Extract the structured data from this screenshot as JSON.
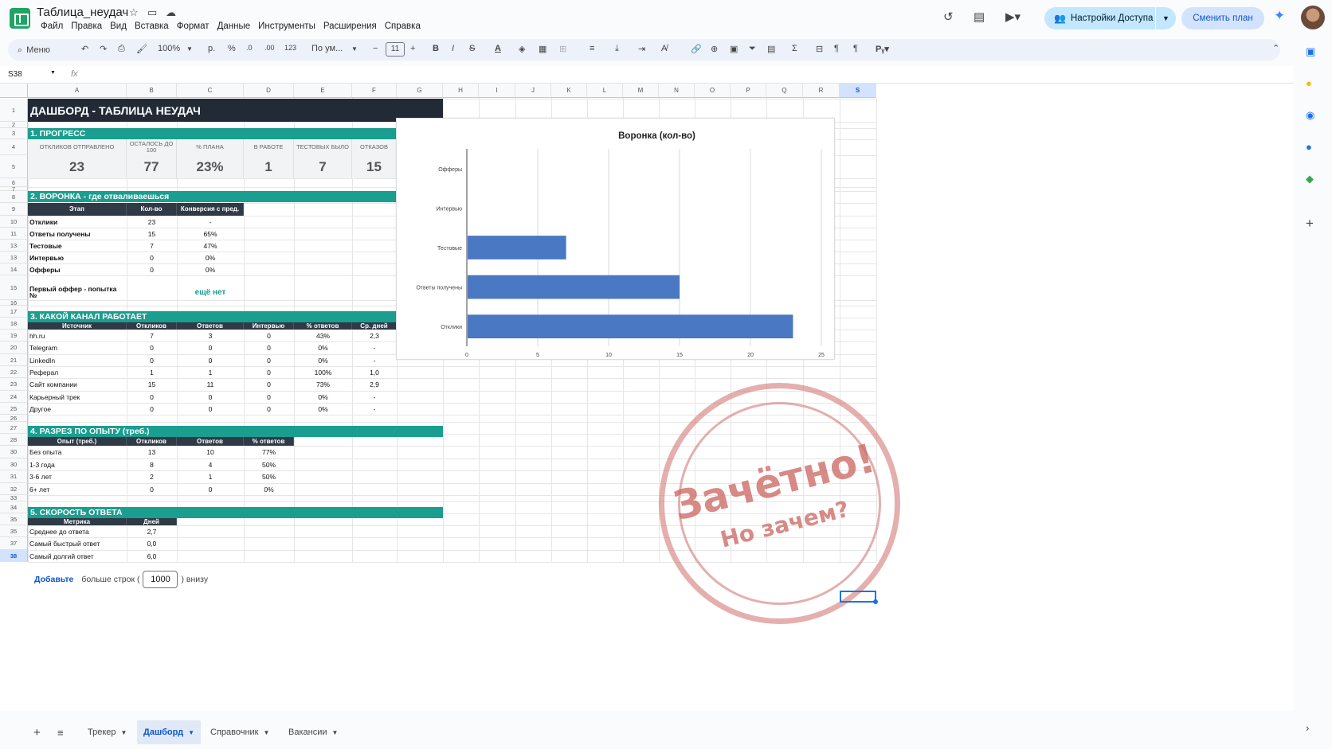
{
  "app": {
    "doc_title": "Таблица_неудач",
    "menu": [
      "Файл",
      "Правка",
      "Вид",
      "Вставка",
      "Формат",
      "Данные",
      "Инструменты",
      "Расширения",
      "Справка"
    ],
    "share_label": "Настройки Доступа",
    "plan_label": "Сменить план"
  },
  "toolbar": {
    "menu_label": "Меню",
    "zoom": "100%",
    "currency": "р.",
    "percent": "%",
    "dec_less": ".0",
    "dec_more": ".00",
    "number_format": "123",
    "font": "По ум...",
    "font_size": "11"
  },
  "formula": {
    "cell_ref": "S38",
    "fx": "fx"
  },
  "columns": [
    "A",
    "B",
    "C",
    "D",
    "E",
    "F",
    "G",
    "H",
    "I",
    "J",
    "K",
    "L",
    "M",
    "N",
    "O",
    "P",
    "Q",
    "R",
    "S"
  ],
  "rows": [
    "1",
    "2",
    "3",
    "4",
    "5",
    "6",
    "7",
    "8",
    "9",
    "10",
    "11",
    "13",
    "13",
    "14",
    "15",
    "16",
    "17",
    "18",
    "19",
    "20",
    "21",
    "22",
    "23",
    "24",
    "25",
    "26",
    "27",
    "28",
    "30",
    "30",
    "31",
    "32",
    "33",
    "34",
    "35",
    "35",
    "37",
    "38"
  ],
  "dashboard": {
    "title": "ДАШБОРД - ТАБЛИЦА НЕУДАЧ",
    "s1": {
      "title": "1. ПРОГРЕСС",
      "labels": [
        "ОТКЛИКОВ ОТПРАВЛЕНО",
        "ОСТАЛОСЬ ДО 100",
        "% ПЛАНА",
        "В РАБОТЕ",
        "ТЕСТОВЫХ БЫЛО",
        "ОТКАЗОВ"
      ],
      "values": [
        "23",
        "77",
        "23%",
        "1",
        "7",
        "15"
      ]
    },
    "s2": {
      "title": "2. ВОРОНКА - где отваливаешься",
      "headers": [
        "Этап",
        "Кол-во",
        "Конверсия с пред."
      ],
      "rows": [
        [
          "Отклики",
          "23",
          "-"
        ],
        [
          "Ответы получены",
          "15",
          "65%"
        ],
        [
          "Тестовые",
          "7",
          "47%"
        ],
        [
          "Интервью",
          "0",
          "0%"
        ],
        [
          "Офферы",
          "0",
          "0%"
        ]
      ],
      "first_offer_label": "Первый оффер - попытка №",
      "first_offer_value": "ещё нет"
    },
    "s3": {
      "title": "3. КАКОЙ КАНАЛ РАБОТАЕТ",
      "headers": [
        "Источник",
        "Откликов",
        "Ответов",
        "Интервью",
        "% ответов",
        "Ср. дней"
      ],
      "rows": [
        [
          "hh.ru",
          "7",
          "3",
          "0",
          "43%",
          "2,3"
        ],
        [
          "Telegram",
          "0",
          "0",
          "0",
          "0%",
          "-"
        ],
        [
          "LinkedIn",
          "0",
          "0",
          "0",
          "0%",
          "-"
        ],
        [
          "Реферал",
          "1",
          "1",
          "0",
          "100%",
          "1,0"
        ],
        [
          "Сайт компании",
          "15",
          "11",
          "0",
          "73%",
          "2,9"
        ],
        [
          "Карьерный трек",
          "0",
          "0",
          "0",
          "0%",
          "-"
        ],
        [
          "Другое",
          "0",
          "0",
          "0",
          "0%",
          "-"
        ]
      ]
    },
    "s4": {
      "title": "4. РАЗРЕЗ ПО ОПЫТУ (треб.)",
      "headers": [
        "Опыт (треб.)",
        "Откликов",
        "Ответов",
        "% ответов"
      ],
      "rows": [
        [
          "Без опыта",
          "13",
          "10",
          "77%"
        ],
        [
          "1-3 года",
          "8",
          "4",
          "50%"
        ],
        [
          "3-6 лет",
          "2",
          "1",
          "50%"
        ],
        [
          "6+ лет",
          "0",
          "0",
          "0%"
        ]
      ]
    },
    "s5": {
      "title": "5. СКОРОСТЬ ОТВЕТА",
      "headers": [
        "Метрика",
        "Дней"
      ],
      "rows": [
        [
          "Среднее до ответа",
          "2,7"
        ],
        [
          "Самый быстрый ответ",
          "0,0"
        ],
        [
          "Самый долгий ответ",
          "6,0"
        ]
      ]
    }
  },
  "chart_data": {
    "type": "bar",
    "orientation": "horizontal",
    "title": "Воронка (кол-во)",
    "categories": [
      "Офферы",
      "Интервью",
      "Тестовые",
      "Ответы получены",
      "Отклики"
    ],
    "values": [
      0,
      0,
      7,
      15,
      23
    ],
    "xlim": [
      0,
      25
    ],
    "xticks": [
      "0",
      "5",
      "10",
      "15",
      "20",
      "25"
    ],
    "grid": true,
    "color": "#4a78c2"
  },
  "stamp": {
    "line1": "Зачётно!",
    "line2": "Но зачем?"
  },
  "add_rows": {
    "link": "Добавьте",
    "text_before": "больше строк (",
    "count": "1000",
    "text_after": ") внизу"
  },
  "sheets": [
    {
      "name": "Трекер",
      "active": false
    },
    {
      "name": "Дашборд",
      "active": true
    },
    {
      "name": "Справочник",
      "active": false
    },
    {
      "name": "Вакансии",
      "active": false
    }
  ]
}
